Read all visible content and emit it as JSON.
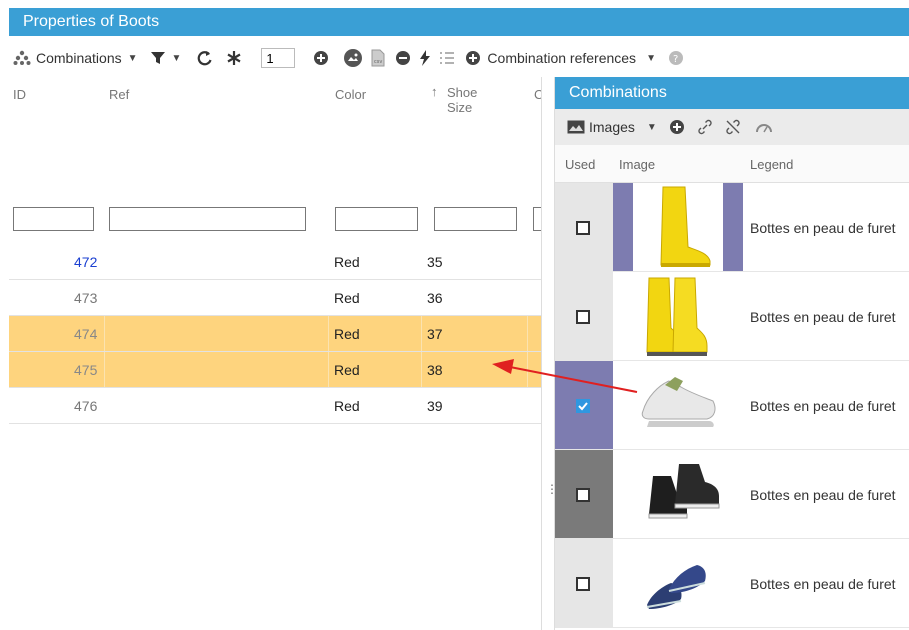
{
  "window": {
    "title": "Properties of Boots"
  },
  "toolbar": {
    "combinations_label": "Combinations",
    "page_value": "1",
    "references_label": "Combination references"
  },
  "grid": {
    "headers": {
      "id": "ID",
      "ref": "Ref",
      "color": "Color",
      "size_line1": "Shoe",
      "size_line2": "Size",
      "next": "C"
    },
    "rows": [
      {
        "id": "472",
        "color": "Red",
        "size": "35",
        "selected": false,
        "id_color": "#1a3fd1"
      },
      {
        "id": "473",
        "color": "Red",
        "size": "36",
        "selected": false,
        "id_color": "#777777"
      },
      {
        "id": "474",
        "color": "Red",
        "size": "37",
        "selected": true,
        "id_color": "#888888"
      },
      {
        "id": "475",
        "color": "Red",
        "size": "38",
        "selected": true,
        "id_color": "#888888"
      },
      {
        "id": "476",
        "color": "Red",
        "size": "39",
        "selected": false,
        "id_color": "#777777"
      }
    ]
  },
  "panel": {
    "title": "Combinations",
    "images_label": "Images",
    "headers": {
      "used": "Used",
      "image": "Image",
      "legend": "Legend"
    },
    "rows": [
      {
        "checked": false,
        "legend": "Bottes en peau de furet",
        "image_icon": "yellow-tall-boot-image"
      },
      {
        "checked": false,
        "legend": "Bottes en peau de furet",
        "image_icon": "yellow-short-boots-image"
      },
      {
        "checked": true,
        "legend": "Bottes en peau de furet",
        "image_icon": "white-sneaker-image"
      },
      {
        "checked": false,
        "legend": "Bottes en peau de furet",
        "image_icon": "black-sneakers-image"
      },
      {
        "checked": false,
        "legend": "Bottes en peau de furet",
        "image_icon": "blue-shoes-image"
      }
    ]
  },
  "colors": {
    "title_bar": "#3a9fd5",
    "selected_row": "#fed47e",
    "used_column": "#e6e6e6",
    "used_column_selected": "#7d7cb0",
    "used_column_dark": "#7a7a7a",
    "image_frame": "#7d7cb0",
    "checkbox_on": "#2f97e0",
    "arrow": "#e02020"
  }
}
